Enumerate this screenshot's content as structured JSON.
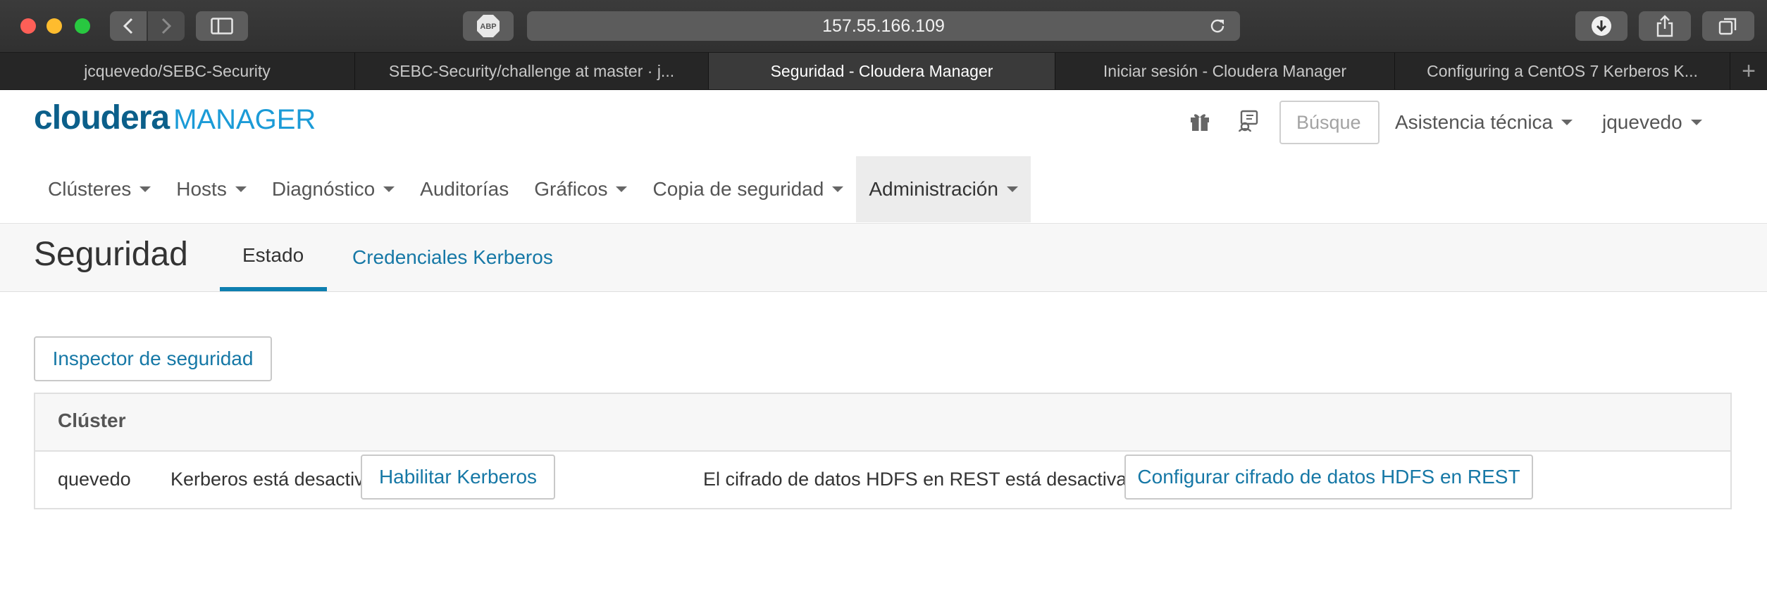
{
  "browser": {
    "url": "157.55.166.109",
    "tabs": [
      {
        "title": "jcquevedo/SEBC-Security",
        "active": false
      },
      {
        "title": "SEBC-Security/challenge at master · j...",
        "active": false
      },
      {
        "title": "Seguridad - Cloudera Manager",
        "active": true
      },
      {
        "title": "Iniciar sesión - Cloudera Manager",
        "active": false
      },
      {
        "title": "Configuring a CentOS 7 Kerberos K...",
        "active": false
      }
    ],
    "new_tab_glyph": "+",
    "icons": [
      "back-icon",
      "forward-icon",
      "sidebar-icon",
      "adblock-icon",
      "reload-icon",
      "download-icon",
      "share-icon",
      "tabs-icon"
    ],
    "adblock_label": "ABP"
  },
  "header": {
    "logo_brand": "cloudera",
    "logo_product": "MANAGER",
    "search_placeholder": "Búsque",
    "support_label": "Asistencia técnica",
    "user_label": "jquevedo",
    "icons": [
      "gift-icon",
      "support-icon"
    ]
  },
  "nav": {
    "items": [
      {
        "label": "Clústeres",
        "dropdown": true,
        "active": false
      },
      {
        "label": "Hosts",
        "dropdown": true,
        "active": false
      },
      {
        "label": "Diagnóstico",
        "dropdown": true,
        "active": false
      },
      {
        "label": "Auditorías",
        "dropdown": false,
        "active": false
      },
      {
        "label": "Gráficos",
        "dropdown": true,
        "active": false
      },
      {
        "label": "Copia de seguridad",
        "dropdown": true,
        "active": false
      },
      {
        "label": "Administración",
        "dropdown": true,
        "active": true
      }
    ]
  },
  "page": {
    "title": "Seguridad",
    "tabs": [
      {
        "label": "Estado",
        "active": true
      },
      {
        "label": "Credenciales Kerberos",
        "active": false
      }
    ],
    "inspector_button": "Inspector de seguridad"
  },
  "cluster_table": {
    "header": "Clúster",
    "rows": [
      {
        "cluster": "quevedo",
        "kerberos_status": "Kerberos está desactivado.",
        "kerberos_button": "Habilitar Kerberos",
        "hdfs_status": "El cifrado de datos HDFS en REST está desactivado",
        "hdfs_button": "Configurar cifrado de datos HDFS en REST"
      }
    ]
  },
  "colors": {
    "brand_dark": "#0b5f8a",
    "brand_light": "#1b9bd7",
    "link": "#1678a6",
    "active_tab_underline": "#0e7fb0"
  }
}
